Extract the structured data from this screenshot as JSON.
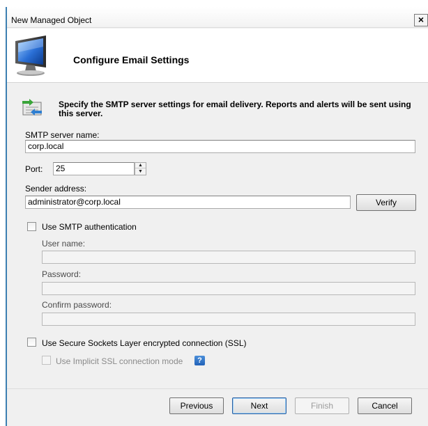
{
  "window": {
    "title": "New Managed Object",
    "close_glyph": "×"
  },
  "header": {
    "title": "Configure Email Settings",
    "icon": "computer-monitor-icon"
  },
  "info": {
    "icon": "email-transfer-icon",
    "text": "Specify the SMTP server settings for email delivery. Reports and alerts will be sent using this server."
  },
  "form": {
    "smtp_server": {
      "label": "SMTP server name:",
      "value": "corp.local"
    },
    "port": {
      "label": "Port:",
      "value": "25"
    },
    "sender": {
      "label": "Sender address:",
      "value": "administrator@corp.local"
    },
    "verify_label": "Verify",
    "smtp_auth": {
      "label": "Use SMTP authentication",
      "checked": false,
      "user_label": "User name:",
      "user_value": "",
      "password_label": "Password:",
      "password_value": "",
      "confirm_label": "Confirm password:",
      "confirm_value": ""
    },
    "ssl": {
      "label": "Use Secure Sockets Layer encrypted connection (SSL)",
      "checked": false
    },
    "implicit_ssl": {
      "label": "Use Implicit SSL connection mode",
      "checked": false,
      "help_glyph": "?"
    }
  },
  "buttons": {
    "previous": "Previous",
    "next": "Next",
    "finish": "Finish",
    "cancel": "Cancel"
  },
  "colors": {
    "window_border": "#3c7fb1",
    "help_icon": "#2c6ec4",
    "dialog_bg": "#f0f0f0"
  }
}
